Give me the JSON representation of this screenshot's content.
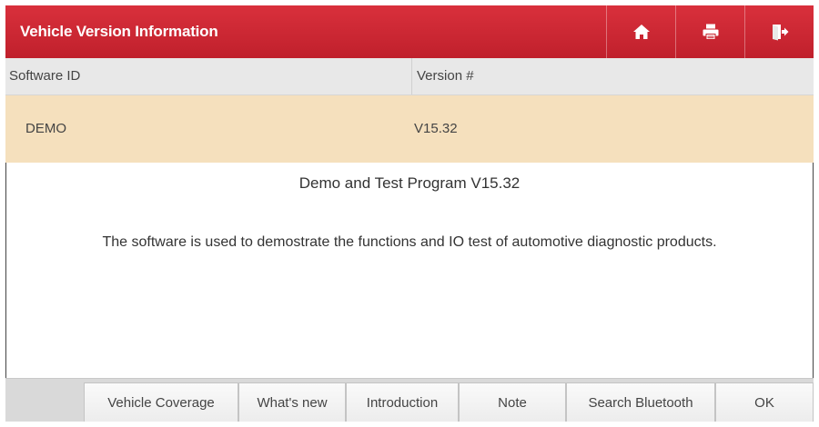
{
  "window": {
    "title": "Vehicle Version Information",
    "accent_color": "#c8242f",
    "toolbar_icons": [
      "home-icon",
      "print-icon",
      "exit-icon"
    ]
  },
  "table": {
    "headers": [
      "Software ID",
      "Version #"
    ],
    "rows": [
      [
        "DEMO",
        "V15.32"
      ]
    ],
    "selected_row_color": "#f5e0bd"
  },
  "details": {
    "program_title": "Demo and Test Program V15.32",
    "description": "The software is used to demostrate the functions and IO test of automotive diagnostic products."
  },
  "buttons": [
    "Vehicle Coverage",
    "What's new",
    "Introduction",
    "Note",
    "Search Bluetooth",
    "OK"
  ]
}
